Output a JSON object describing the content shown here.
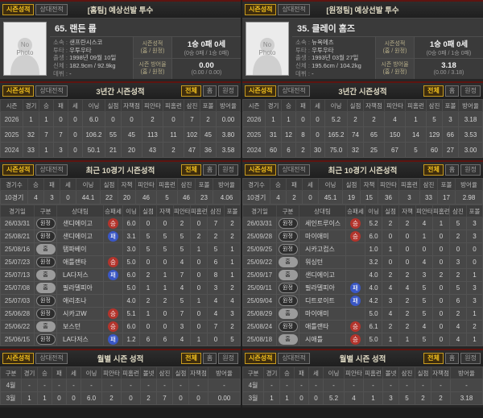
{
  "colors": {
    "accent_gold": "#f3c11d",
    "section_border_red": "#5e1410",
    "win_badge_red": "#b3342c",
    "loss_badge_blue": "#3a57c5"
  },
  "tabs": {
    "season": "시즌성적",
    "h2h": "상대전적"
  },
  "filters": {
    "all": "전체",
    "home": "홈",
    "away": "원정"
  },
  "columns": {
    "three_year": [
      "시즌",
      "경기",
      "승",
      "패",
      "세",
      "이닝",
      "실점",
      "자책점",
      "피안타",
      "피홈런",
      "삼진",
      "포볼",
      "방어율"
    ],
    "recent_summary": [
      "경기수",
      "승",
      "패",
      "세",
      "이닝",
      "실점",
      "자책",
      "피안타",
      "피홈런",
      "삼진",
      "포볼",
      "방어율"
    ],
    "recent_detail": [
      "경기일",
      "구분",
      "상대팀",
      "승패세",
      "이닝",
      "실점",
      "자책",
      "피안타",
      "피홈런",
      "삼진",
      "포볼"
    ],
    "monthly": [
      "구분",
      "경기",
      "승",
      "패",
      "세",
      "이닝",
      "피안타",
      "피홈런",
      "볼넷",
      "삼진",
      "실점",
      "자책점",
      "방어율"
    ]
  },
  "panels": [
    {
      "header_title": "[홈팀] 예상선발 투수",
      "profile": {
        "photo_text": "No Photo",
        "name": "65. 랜든 룹",
        "info": [
          {
            "label": "소속 :",
            "value": "샌프란시스코"
          },
          {
            "label": "투타 :",
            "value": "우투우타"
          },
          {
            "label": "출생 :",
            "value": "1998년 09월 10일"
          },
          {
            "label": "신체 :",
            "value": "182.9cm / 92.9kg"
          },
          {
            "label": "데뷔 :",
            "value": "-"
          }
        ],
        "season_label": "시즌성적",
        "season_scope": "(홈 / 원정)",
        "season_value": "1승 0패 0세",
        "season_sub": "(0승 0패 / 1승 0패)",
        "era_label": "시즌 방어율",
        "era_scope": "(홈 / 원정)",
        "era_value": "0.00",
        "era_sub": "(0.00 / 0.00)"
      },
      "three_year": {
        "title": "3년간 시즌성적",
        "rows": [
          {
            "season": "2026",
            "g": "1",
            "w": "1",
            "l": "0",
            "sv": "0",
            "ip": "6.0",
            "r": "0",
            "er": "0",
            "h": "2",
            "hr": "0",
            "so": "7",
            "bb": "2",
            "era": "0.00"
          },
          {
            "season": "2025",
            "g": "32",
            "w": "7",
            "l": "7",
            "sv": "0",
            "ip": "106.2",
            "r": "55",
            "er": "45",
            "h": "113",
            "hr": "11",
            "so": "102",
            "bb": "45",
            "era": "3.80"
          },
          {
            "season": "2024",
            "g": "33",
            "w": "1",
            "l": "3",
            "sv": "0",
            "ip": "50.1",
            "r": "21",
            "er": "20",
            "h": "43",
            "hr": "2",
            "so": "47",
            "bb": "36",
            "era": "3.58"
          }
        ]
      },
      "recent10": {
        "title": "최근 10경기 시즌성적",
        "summary": {
          "label": "10경기",
          "w": "4",
          "l": "3",
          "sv": "0",
          "ip": "44.1",
          "r": "22",
          "er": "20",
          "h": "46",
          "hr": "5",
          "so": "46",
          "bb": "23",
          "era": "4.06"
        },
        "games": [
          {
            "date": "26/03/31",
            "loc": "원정",
            "opp": "샌디에이고",
            "result": "승",
            "ip": "6.0",
            "r": "0",
            "er": "0",
            "h": "2",
            "hr": "0",
            "so": "7",
            "bb": "2"
          },
          {
            "date": "25/08/21",
            "loc": "원정",
            "opp": "샌디에이고",
            "result": "패",
            "ip": "3.1",
            "r": "5",
            "er": "5",
            "h": "5",
            "hr": "2",
            "so": "2",
            "bb": "2"
          },
          {
            "date": "25/08/16",
            "loc": "홈",
            "opp": "탬파베이",
            "result": "",
            "ip": "3.0",
            "r": "5",
            "er": "5",
            "h": "5",
            "hr": "1",
            "so": "5",
            "bb": "1"
          },
          {
            "date": "25/07/23",
            "loc": "원정",
            "opp": "애틀랜타",
            "result": "승",
            "ip": "5.0",
            "r": "0",
            "er": "0",
            "h": "4",
            "hr": "0",
            "so": "6",
            "bb": "1"
          },
          {
            "date": "25/07/13",
            "loc": "홈",
            "opp": "LA다저스",
            "result": "패",
            "ip": "6.0",
            "r": "2",
            "er": "1",
            "h": "7",
            "hr": "0",
            "so": "8",
            "bb": "1"
          },
          {
            "date": "25/07/08",
            "loc": "홈",
            "opp": "필라델피아",
            "result": "",
            "ip": "5.0",
            "r": "1",
            "er": "1",
            "h": "4",
            "hr": "0",
            "so": "3",
            "bb": "2"
          },
          {
            "date": "25/07/03",
            "loc": "원정",
            "opp": "애리조나",
            "result": "",
            "ip": "4.0",
            "r": "2",
            "er": "2",
            "h": "5",
            "hr": "1",
            "so": "4",
            "bb": "4"
          },
          {
            "date": "25/06/28",
            "loc": "원정",
            "opp": "시카고W",
            "result": "승",
            "ip": "5.1",
            "r": "1",
            "er": "0",
            "h": "7",
            "hr": "0",
            "so": "4",
            "bb": "3"
          },
          {
            "date": "25/06/22",
            "loc": "홈",
            "opp": "보스턴",
            "result": "승",
            "ip": "6.0",
            "r": "0",
            "er": "0",
            "h": "3",
            "hr": "0",
            "so": "7",
            "bb": "2"
          },
          {
            "date": "25/06/15",
            "loc": "원정",
            "opp": "LA다저스",
            "result": "패",
            "ip": "1.2",
            "r": "6",
            "er": "6",
            "h": "4",
            "hr": "1",
            "so": "0",
            "bb": "5"
          }
        ]
      },
      "monthly": {
        "title": "월별 시즌 성적",
        "rows": [
          {
            "month": "4월",
            "g": "-",
            "w": "-",
            "l": "-",
            "sv": "-",
            "ip": "-",
            "h": "-",
            "hr": "-",
            "bb": "-",
            "so": "-",
            "r": "-",
            "er": "-",
            "era": "-"
          },
          {
            "month": "3월",
            "g": "1",
            "w": "1",
            "l": "0",
            "sv": "0",
            "ip": "6.0",
            "h": "2",
            "hr": "0",
            "bb": "2",
            "so": "7",
            "r": "0",
            "er": "0",
            "era": "0.00"
          }
        ]
      }
    },
    {
      "header_title": "[원정팀] 예상선발 투수",
      "profile": {
        "photo_text": "No Photo",
        "name": "35. 클레이 홈즈",
        "info": [
          {
            "label": "소속 :",
            "value": "뉴욕메츠"
          },
          {
            "label": "투타 :",
            "value": "우투우타"
          },
          {
            "label": "출생 :",
            "value": "1993년 03월 27일"
          },
          {
            "label": "신체 :",
            "value": "195.6cm / 104.2kg"
          },
          {
            "label": "데뷔 :",
            "value": "-"
          }
        ],
        "season_label": "시즌성적",
        "season_scope": "(홈 / 원정)",
        "season_value": "1승 0패 0세",
        "season_sub": "(0승 0패 / 1승 0패)",
        "era_label": "시즌 방어율",
        "era_scope": "(홈 / 원정)",
        "era_value": "3.18",
        "era_sub": "(0.00 / 3.18)"
      },
      "three_year": {
        "title": "3년간 시즌성적",
        "rows": [
          {
            "season": "2026",
            "g": "1",
            "w": "1",
            "l": "0",
            "sv": "0",
            "ip": "5.2",
            "r": "2",
            "er": "2",
            "h": "4",
            "hr": "1",
            "so": "5",
            "bb": "3",
            "era": "3.18"
          },
          {
            "season": "2025",
            "g": "31",
            "w": "12",
            "l": "8",
            "sv": "0",
            "ip": "165.2",
            "r": "74",
            "er": "65",
            "h": "150",
            "hr": "14",
            "so": "129",
            "bb": "66",
            "era": "3.53"
          },
          {
            "season": "2024",
            "g": "60",
            "w": "6",
            "l": "2",
            "sv": "30",
            "ip": "75.0",
            "r": "32",
            "er": "25",
            "h": "67",
            "hr": "5",
            "so": "60",
            "bb": "27",
            "era": "3.00"
          }
        ]
      },
      "recent10": {
        "title": "최근 10경기 시즌성적",
        "summary": {
          "label": "10경기",
          "w": "4",
          "l": "2",
          "sv": "0",
          "ip": "45.1",
          "r": "19",
          "er": "15",
          "h": "36",
          "hr": "3",
          "so": "33",
          "bb": "17",
          "era": "2.98"
        },
        "games": [
          {
            "date": "26/03/31",
            "loc": "원정",
            "opp": "세인트루이스",
            "result": "승",
            "ip": "5.2",
            "r": "2",
            "er": "2",
            "h": "4",
            "hr": "1",
            "so": "5",
            "bb": "3"
          },
          {
            "date": "25/09/28",
            "loc": "원정",
            "opp": "마이애미",
            "result": "승",
            "ip": "6.0",
            "r": "0",
            "er": "0",
            "h": "1",
            "hr": "0",
            "so": "2",
            "bb": "3"
          },
          {
            "date": "25/09/25",
            "loc": "원정",
            "opp": "시카고컵스",
            "result": "",
            "ip": "1.0",
            "r": "1",
            "er": "0",
            "h": "0",
            "hr": "0",
            "so": "0",
            "bb": "0"
          },
          {
            "date": "25/09/22",
            "loc": "홈",
            "opp": "워싱턴",
            "result": "",
            "ip": "3.2",
            "r": "0",
            "er": "0",
            "h": "4",
            "hr": "0",
            "so": "3",
            "bb": "0"
          },
          {
            "date": "25/09/17",
            "loc": "홈",
            "opp": "샌디에이고",
            "result": "",
            "ip": "4.0",
            "r": "2",
            "er": "2",
            "h": "3",
            "hr": "2",
            "so": "2",
            "bb": "1"
          },
          {
            "date": "25/09/11",
            "loc": "원정",
            "opp": "필라델피아",
            "result": "패",
            "ip": "4.0",
            "r": "4",
            "er": "4",
            "h": "5",
            "hr": "0",
            "so": "5",
            "bb": "3"
          },
          {
            "date": "25/09/04",
            "loc": "원정",
            "opp": "디트로이트",
            "result": "패",
            "ip": "4.2",
            "r": "3",
            "er": "2",
            "h": "5",
            "hr": "0",
            "so": "6",
            "bb": "3"
          },
          {
            "date": "25/08/29",
            "loc": "홈",
            "opp": "마이애미",
            "result": "",
            "ip": "5.0",
            "r": "4",
            "er": "2",
            "h": "5",
            "hr": "0",
            "so": "2",
            "bb": "1"
          },
          {
            "date": "25/08/24",
            "loc": "원정",
            "opp": "애틀랜타",
            "result": "승",
            "ip": "6.1",
            "r": "2",
            "er": "2",
            "h": "4",
            "hr": "0",
            "so": "4",
            "bb": "2"
          },
          {
            "date": "25/08/18",
            "loc": "홈",
            "opp": "시애틀",
            "result": "승",
            "ip": "5.0",
            "r": "1",
            "er": "1",
            "h": "5",
            "hr": "0",
            "so": "4",
            "bb": "1"
          }
        ]
      },
      "monthly": {
        "title": "월별 시즌 성적",
        "rows": [
          {
            "month": "4월",
            "g": "-",
            "w": "-",
            "l": "-",
            "sv": "-",
            "ip": "-",
            "h": "-",
            "hr": "-",
            "bb": "-",
            "so": "-",
            "r": "-",
            "er": "-",
            "era": "-"
          },
          {
            "month": "3월",
            "g": "1",
            "w": "1",
            "l": "0",
            "sv": "0",
            "ip": "5.2",
            "h": "4",
            "hr": "1",
            "bb": "3",
            "so": "5",
            "r": "2",
            "er": "2",
            "era": "3.18"
          }
        ]
      }
    }
  ]
}
